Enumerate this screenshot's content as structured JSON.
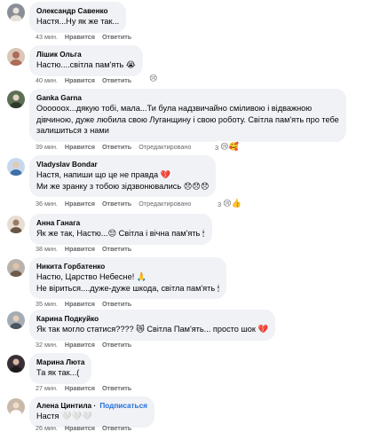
{
  "actions": {
    "like": "Нравится",
    "reply": "Ответить",
    "edited": "Отредактировано",
    "follow": "Подписаться"
  },
  "comments": [
    {
      "author": "Олександр Савенко",
      "lines": [
        "Настя...Ну як же так..."
      ],
      "time": "43 мин.",
      "avatar_color": "#8a8f96"
    },
    {
      "author": "Лішик Ольга",
      "lines": [
        "Настю....світла пам'ять 😭"
      ],
      "time": "40 мин.",
      "reactions": "😢",
      "avatar_color": "#b06a5a"
    },
    {
      "author": "Ganka Garna",
      "lines": [
        "Оооооох...дякую тобі, мала...Ти була надзвичайно сміливою і відважною",
        "дівчиною, дуже любила свою Луганщину і свою роботу. Світла пам'ять про тебе",
        "залишиться з нами"
      ],
      "time": "39 мин.",
      "edited": true,
      "reactions": "😢🥰",
      "reaction_count": "3",
      "avatar_color": "#5c6f55"
    },
    {
      "author": "Vladyslav Bondar",
      "lines": [
        "Настя, напиши що це не правда 💔",
        "Ми же зранку з тобою зідзвонювались 😞😞😞"
      ],
      "time": "36 мин.",
      "edited": true,
      "reactions": "😢👍",
      "reaction_count": "3",
      "avatar_color": "#3e6fa8"
    },
    {
      "author": "Анна Ганага",
      "lines": [
        "Як же так, Настю...😔 Світла і вічна пам'ять 🕯"
      ],
      "time": "38 мин.",
      "avatar_color": "#9a7b63"
    },
    {
      "author": "Никита Горбатенко",
      "lines": [
        "Настю, Царство Небесне! 🙏",
        "Не віриться....дуже-дуже шкода, світла пам'ять 🕯"
      ],
      "time": "35 мин.",
      "avatar_color": "#6d5a4a"
    },
    {
      "author": "Карина Подкуйко",
      "lines": [
        "Як так могло статися???? 😿 Світла Пам'ять... просто шок 💔"
      ],
      "time": "32 мин.",
      "avatar_color": "#4a5560"
    },
    {
      "author": "Марина Люта",
      "lines": [
        "Та як так...("
      ],
      "time": "27 мин.",
      "avatar_color": "#3a2f35"
    },
    {
      "author": "Алена Цинтила",
      "lines": [
        "Настя 🤍🤍🤍"
      ],
      "time": "26 мин.",
      "follow": true,
      "avatar_color": "#c9b9a8"
    }
  ]
}
